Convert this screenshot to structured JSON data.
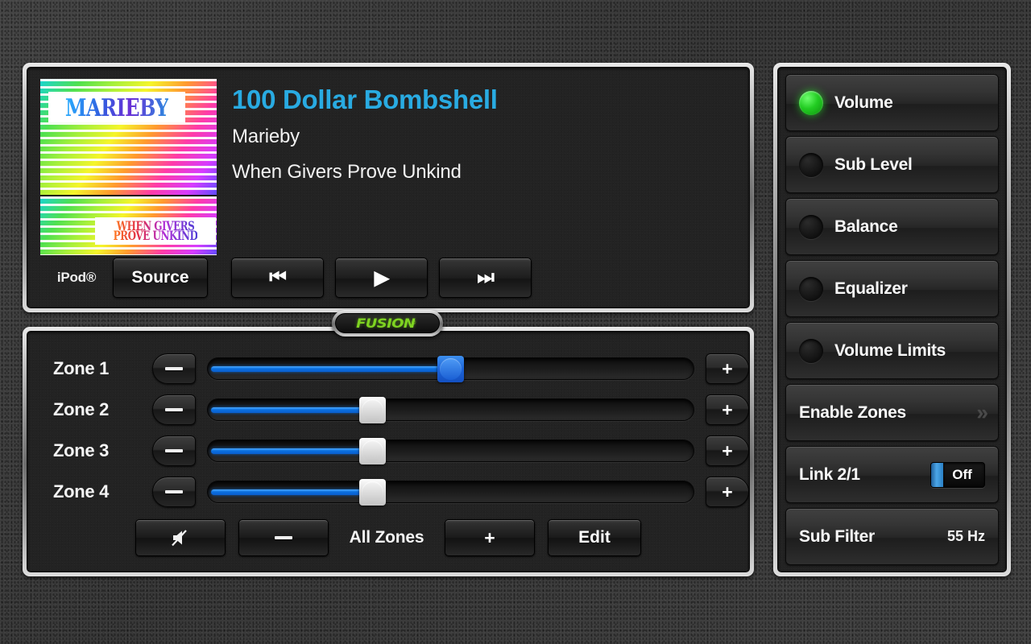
{
  "now_playing": {
    "title": "100 Dollar Bombshell",
    "artist": "Marieby",
    "album": "When Givers Prove Unkind",
    "title_color": "#29ABE2",
    "album_art": {
      "top_word": "MARIEBY",
      "bottom_line1": "WHEN GIVERS",
      "bottom_line2": "PROVE UNKIND"
    },
    "source_label": "iPod®",
    "source_button": "Source",
    "transport": {
      "previous": "⏮",
      "play": "▶",
      "next": "⏭",
      "previous_name": "previous-track",
      "play_name": "play",
      "next_name": "next-track"
    }
  },
  "brand": {
    "name": "FUSION",
    "registered": "®",
    "color": "#7ED321"
  },
  "zones": {
    "rows": [
      {
        "label": "Zone 1",
        "minus": "—",
        "plus": "+",
        "fill_percent": 50,
        "thumb": "blue"
      },
      {
        "label": "Zone 2",
        "minus": "—",
        "plus": "+",
        "fill_percent": 33,
        "thumb": "silver"
      },
      {
        "label": "Zone 3",
        "minus": "—",
        "plus": "+",
        "fill_percent": 33,
        "thumb": "silver"
      },
      {
        "label": "Zone 4",
        "minus": "—",
        "plus": "+",
        "fill_percent": 33,
        "thumb": "silver"
      }
    ],
    "all_zones": {
      "mute_icon": "mute-icon",
      "minus": "—",
      "label": "All Zones",
      "plus": "+",
      "edit": "Edit"
    },
    "slider_fill_color": "#0A6FE0",
    "active_thumb_color": "#1C63D8"
  },
  "sidebar": {
    "items": [
      {
        "label": "Volume",
        "type": "led",
        "led": "on"
      },
      {
        "label": "Sub Level",
        "type": "led",
        "led": "off"
      },
      {
        "label": "Balance",
        "type": "led",
        "led": "off"
      },
      {
        "label": "Equalizer",
        "type": "led",
        "led": "off"
      },
      {
        "label": "Volume Limits",
        "type": "led",
        "led": "off"
      },
      {
        "label": "Enable Zones",
        "type": "chevron",
        "chevron": "»"
      },
      {
        "label": "Link 2/1",
        "type": "toggle",
        "toggle_state": "Off"
      },
      {
        "label": "Sub Filter",
        "type": "value",
        "value": "55 Hz"
      }
    ],
    "led_on_color": "#22CC22"
  }
}
